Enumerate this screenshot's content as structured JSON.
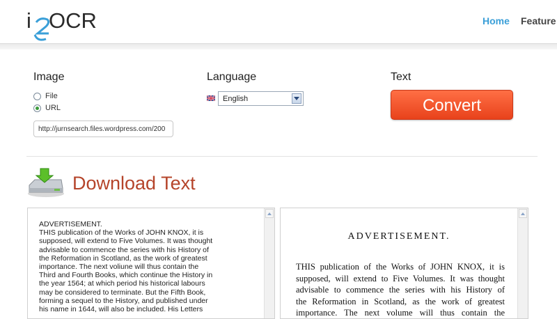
{
  "header": {
    "logo_i": "i",
    "logo_rest": "OCR",
    "nav": [
      {
        "label": "Home"
      },
      {
        "label": "Feature"
      }
    ]
  },
  "form": {
    "image_label": "Image",
    "language_label": "Language",
    "text_label": "Text",
    "radio_file": "File",
    "radio_url": "URL",
    "url_value": "http://jurnsearch.files.wordpress.com/200",
    "language_selected": "English",
    "convert_label": "Convert"
  },
  "download": {
    "title": "Download Text"
  },
  "ocr_lines": [
    "ADVERTISEMENT.",
    "THIS publication of the Works of JOHN KNOX, it is",
    "supposed, will extend to Five Volumes. It was thought",
    "advisable to commence the series with his History of",
    "the Reformation in Scotland, as the work of greatest",
    "importance. The next voliune will thus contain the",
    "Third and Fourth Books, which continue the History in",
    "the year 1564; at which period his historical labours",
    "may be considered to terminate. But the Fifth Book,",
    "forming a sequel to the History, and published under",
    "his name in 1644, will also be included. His Letters"
  ],
  "scan": {
    "title": "ADVERTISEMENT.",
    "lines": [
      "THIS publication of the Works of JOHN KNOX, it is",
      "supposed, will extend to Five Volumes.  It was thought",
      "advisable to commence the series with his History of",
      "the Reformation in Scotland, as the work of greatest",
      "importance.  The next volume will thus contain the"
    ]
  },
  "colors": {
    "accent_blue": "#3a9fd8",
    "convert_orange": "#f05a2c",
    "title_red": "#b5442a"
  }
}
